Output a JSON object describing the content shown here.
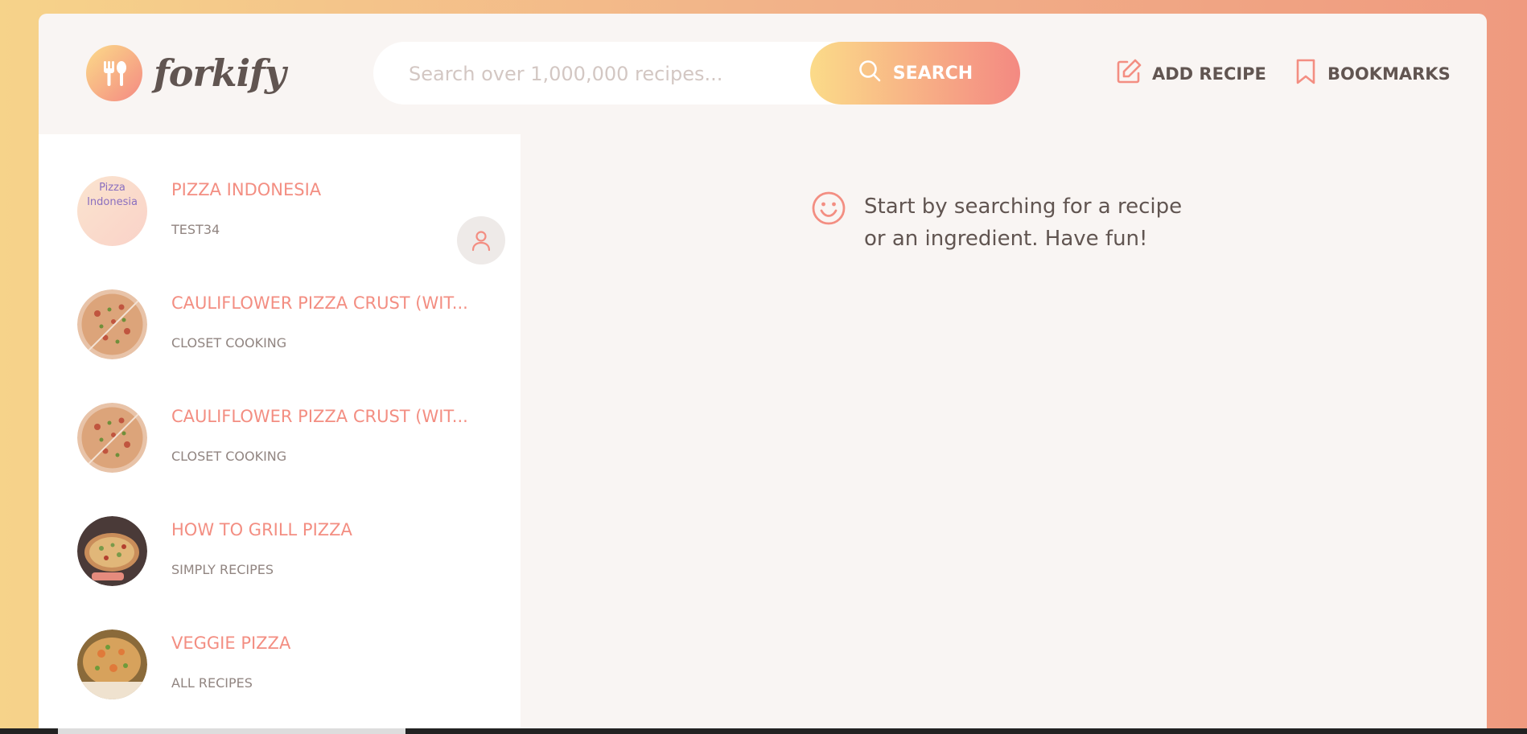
{
  "app": {
    "name": "forkify"
  },
  "search": {
    "placeholder": "Search over 1,000,000 recipes...",
    "button_label": "SEARCH"
  },
  "nav": {
    "add_recipe": "ADD RECIPE",
    "bookmarks": "BOOKMARKS"
  },
  "results": [
    {
      "title": "PIZZA INDONESIA",
      "publisher": "TEST34",
      "image_alt": "Pizza Indonesia",
      "user_generated": true
    },
    {
      "title": "CAULIFLOWER PIZZA CRUST (WIT...",
      "publisher": "CLOSET COOKING"
    },
    {
      "title": "CAULIFLOWER PIZZA CRUST (WIT...",
      "publisher": "CLOSET COOKING"
    },
    {
      "title": "HOW TO GRILL PIZZA",
      "publisher": "SIMPLY RECIPES"
    },
    {
      "title": "VEGGIE PIZZA",
      "publisher": "ALL RECIPES"
    }
  ],
  "message": {
    "text": "Start by searching for a recipe or an ingredient. Have fun!"
  },
  "colors": {
    "accent": "#f38e82",
    "gradient_start": "#fbdb89",
    "gradient_end": "#f48982",
    "text": "#615551"
  },
  "icons": {
    "logo": "fork-spoon-icon",
    "search": "search-icon",
    "add_recipe": "edit-icon",
    "bookmarks": "bookmark-icon",
    "user_generated": "user-icon",
    "message": "smile-icon"
  }
}
